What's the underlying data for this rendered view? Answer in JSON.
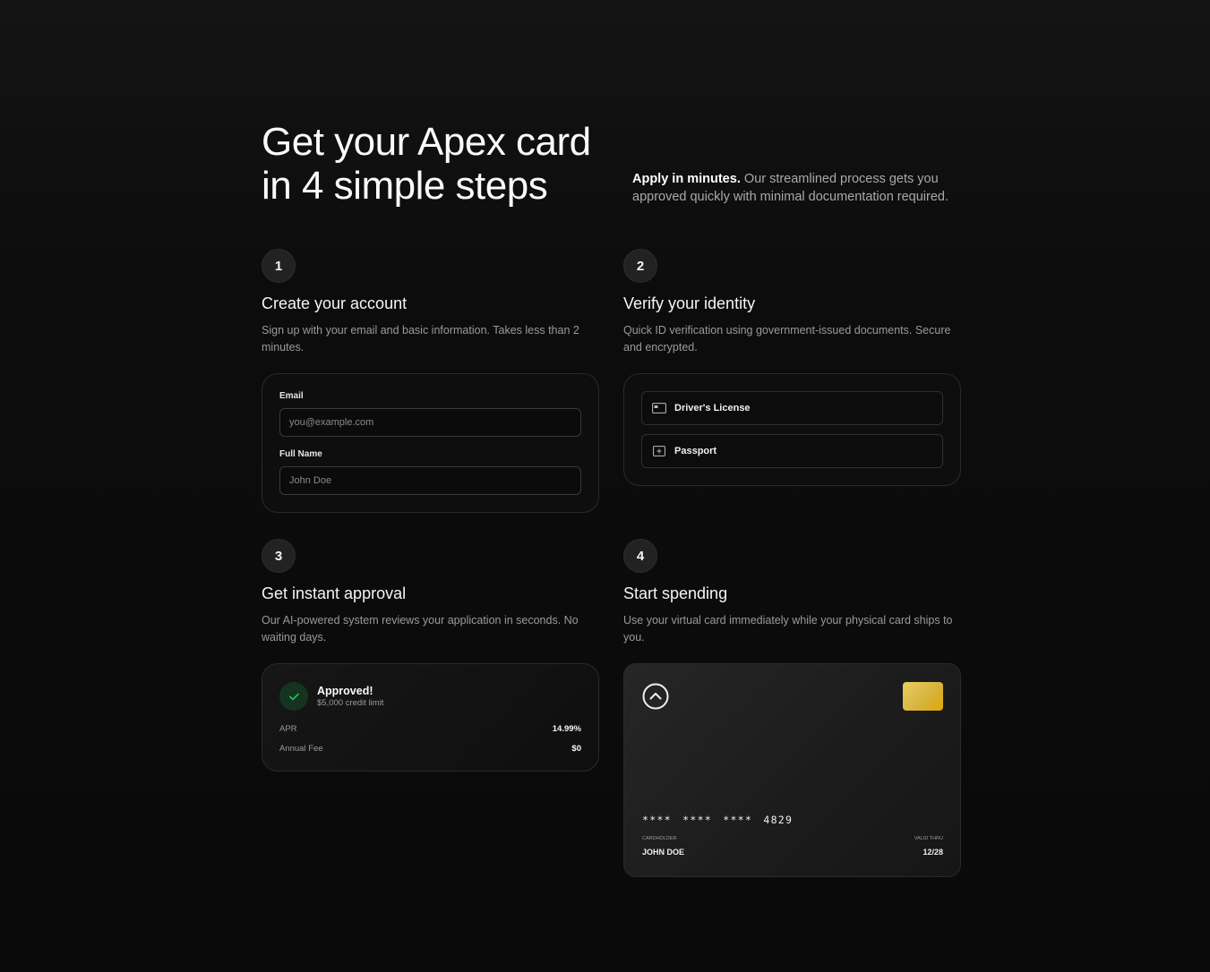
{
  "hero": {
    "title_line1": "Get your Apex card",
    "title_line2": "in 4 simple steps",
    "lead_bold": "Apply in minutes.",
    "lead_rest": " Our streamlined process gets you approved quickly with minimal documentation required."
  },
  "steps": [
    {
      "number": "1",
      "title": "Create your account",
      "description": "Sign up with your email and basic information. Takes less than 2 minutes.",
      "form": {
        "email_label": "Email",
        "email_placeholder": "you@example.com",
        "name_label": "Full Name",
        "name_placeholder": "John Doe"
      }
    },
    {
      "number": "2",
      "title": "Verify your identity",
      "description": "Quick ID verification using government-issued documents. Secure and encrypted.",
      "documents": [
        {
          "label": "Driver's License",
          "icon": "id-card-icon"
        },
        {
          "label": "Passport",
          "icon": "passport-icon"
        }
      ]
    },
    {
      "number": "3",
      "title": "Get instant approval",
      "description": "Our AI-powered system reviews your application in seconds. No waiting days.",
      "approval": {
        "status": "Approved!",
        "limit": "$5,000 credit limit",
        "apr_label": "APR",
        "apr_value": "14.99%",
        "fee_label": "Annual Fee",
        "fee_value": "$0"
      }
    },
    {
      "number": "4",
      "title": "Start spending",
      "description": "Use your virtual card immediately while your physical card ships to you.",
      "card": {
        "number": "**** **** **** 4829",
        "holder_label": "Cardholder",
        "holder_value": "JOHN DOE",
        "valid_label": "Valid Thru",
        "valid_value": "12/28"
      }
    }
  ],
  "colors": {
    "background": "#0a0a0a",
    "approved_green": "#22c55e",
    "chip_gold": "#d6b23a"
  }
}
